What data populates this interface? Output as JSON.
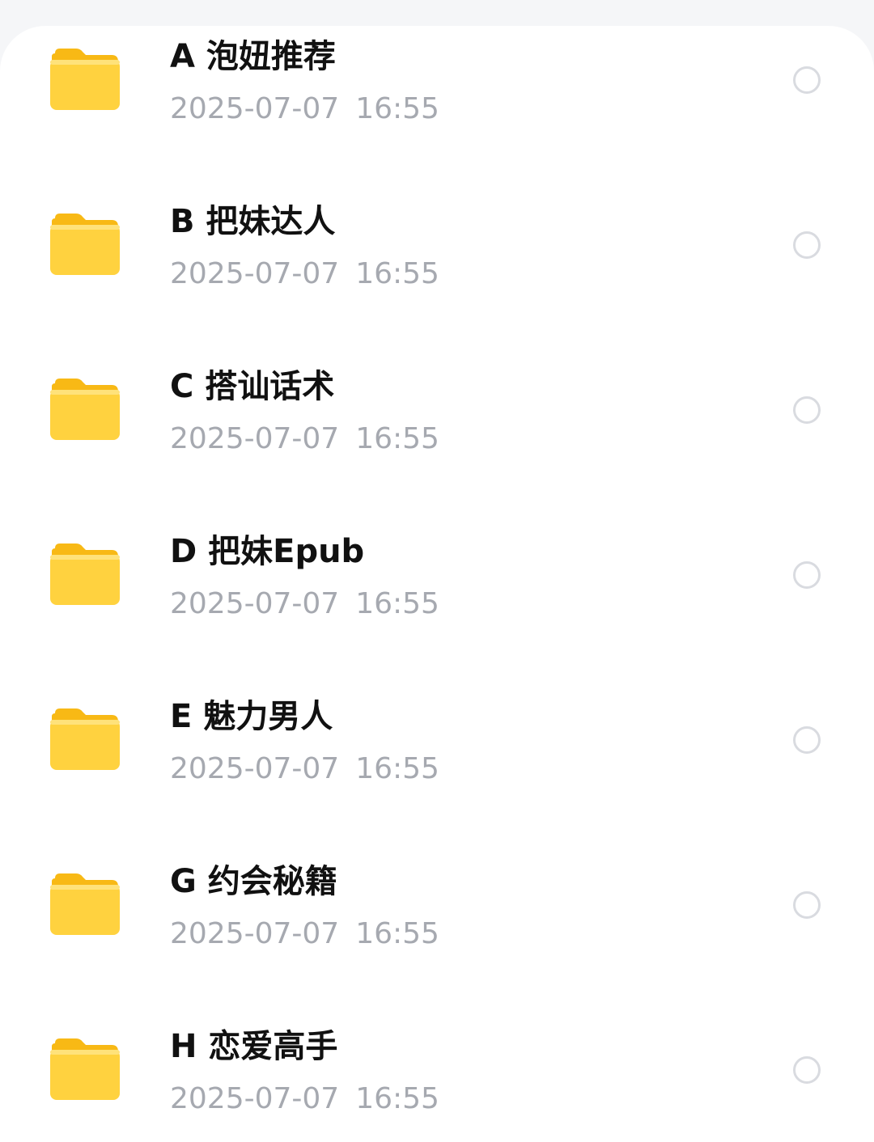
{
  "folders": [
    {
      "name": "A 泡妞推荐",
      "date": "2025-07-07",
      "time": "16:55"
    },
    {
      "name": "B 把妹达人",
      "date": "2025-07-07",
      "time": "16:55"
    },
    {
      "name": "C 搭讪话术",
      "date": "2025-07-07",
      "time": "16:55"
    },
    {
      "name": "D 把妹Epub",
      "date": "2025-07-07",
      "time": "16:55"
    },
    {
      "name": "E 魅力男人",
      "date": "2025-07-07",
      "time": "16:55"
    },
    {
      "name": "G 约会秘籍",
      "date": "2025-07-07",
      "time": "16:55"
    },
    {
      "name": "H 恋爱高手",
      "date": "2025-07-07",
      "time": "16:55"
    }
  ],
  "colors": {
    "folder_body": "#FFD23F",
    "folder_tab": "#F8B915",
    "title_text": "#111111",
    "meta_text": "#A6A9B0",
    "radio_border": "#D9DBE0"
  },
  "icons": {
    "folder": "folder-icon",
    "select": "radio-unchecked-icon"
  }
}
